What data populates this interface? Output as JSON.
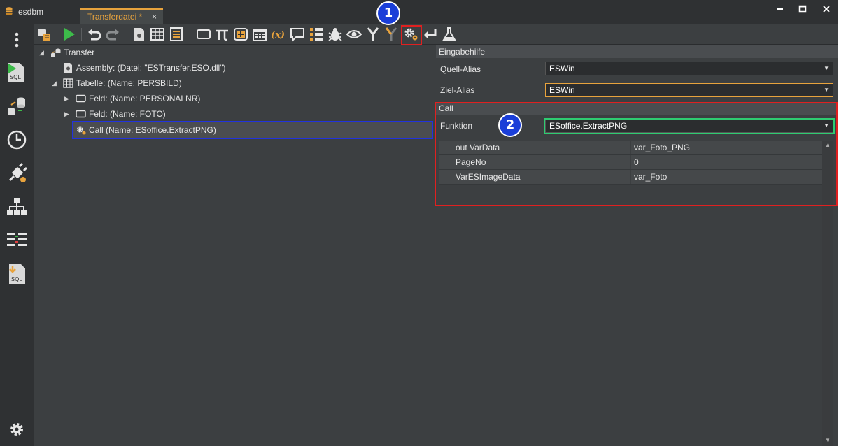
{
  "app": {
    "name": "esdbm"
  },
  "tab": {
    "label": "Transferdatei *",
    "close": "×"
  },
  "window": {
    "minimize": "▁",
    "maximize": "☐",
    "close": "✕"
  },
  "colors": {
    "accent": "#e8a33d",
    "annotation_red": "#e02020",
    "annotation_green": "#2ecc71",
    "selection_blue": "#2233dd",
    "badge_blue": "#1a3ed8"
  },
  "toolbar": {
    "icons": [
      "database-script-icon",
      "run-icon",
      "undo-icon",
      "redo-icon",
      "assembly-icon",
      "table-icon",
      "list-icon",
      "rectangle-icon",
      "pi-icon",
      "add-box-icon",
      "calendar-icon",
      "variable-icon",
      "comment-icon",
      "tree-list-icon",
      "debug-bug-icon",
      "watch-eye-icon",
      "merge-icon",
      "merge-disabled-icon",
      "call-gears-icon",
      "return-icon",
      "flask-icon"
    ]
  },
  "sidebar": {
    "icons": [
      "more-vertical-icon",
      "sql-run-icon",
      "database-transfer-icon",
      "history-clock-icon",
      "plugin-icon",
      "hierarchy-icon",
      "mapping-icon",
      "sql-export-icon",
      "settings-gear-icon"
    ]
  },
  "tree": {
    "root": "Transfer",
    "assembly": "Assembly: (Datei: \"ESTransfer.ESO.dll\")",
    "table": "Tabelle: (Name: PERSBILD)",
    "field1": "Feld: (Name: PERSONALNR)",
    "field2": "Feld: (Name: FOTO)",
    "call": "Call (Name: ESoffice.ExtractPNG)"
  },
  "props": {
    "section_input": "Eingabehilfe",
    "source_alias_label": "Quell-Alias",
    "source_alias_value": "ESWin",
    "target_alias_label": "Ziel-Alias",
    "target_alias_value": "ESWin",
    "section_call": "Call",
    "function_label": "Funktion",
    "function_value": "ESoffice.ExtractPNG",
    "params": [
      {
        "name": "out VarData",
        "value": "var_Foto_PNG"
      },
      {
        "name": "PageNo",
        "value": "0"
      },
      {
        "name": "VarESImageData",
        "value": "var_Foto"
      }
    ]
  },
  "annotations": {
    "badge1": "1",
    "badge2": "2"
  }
}
